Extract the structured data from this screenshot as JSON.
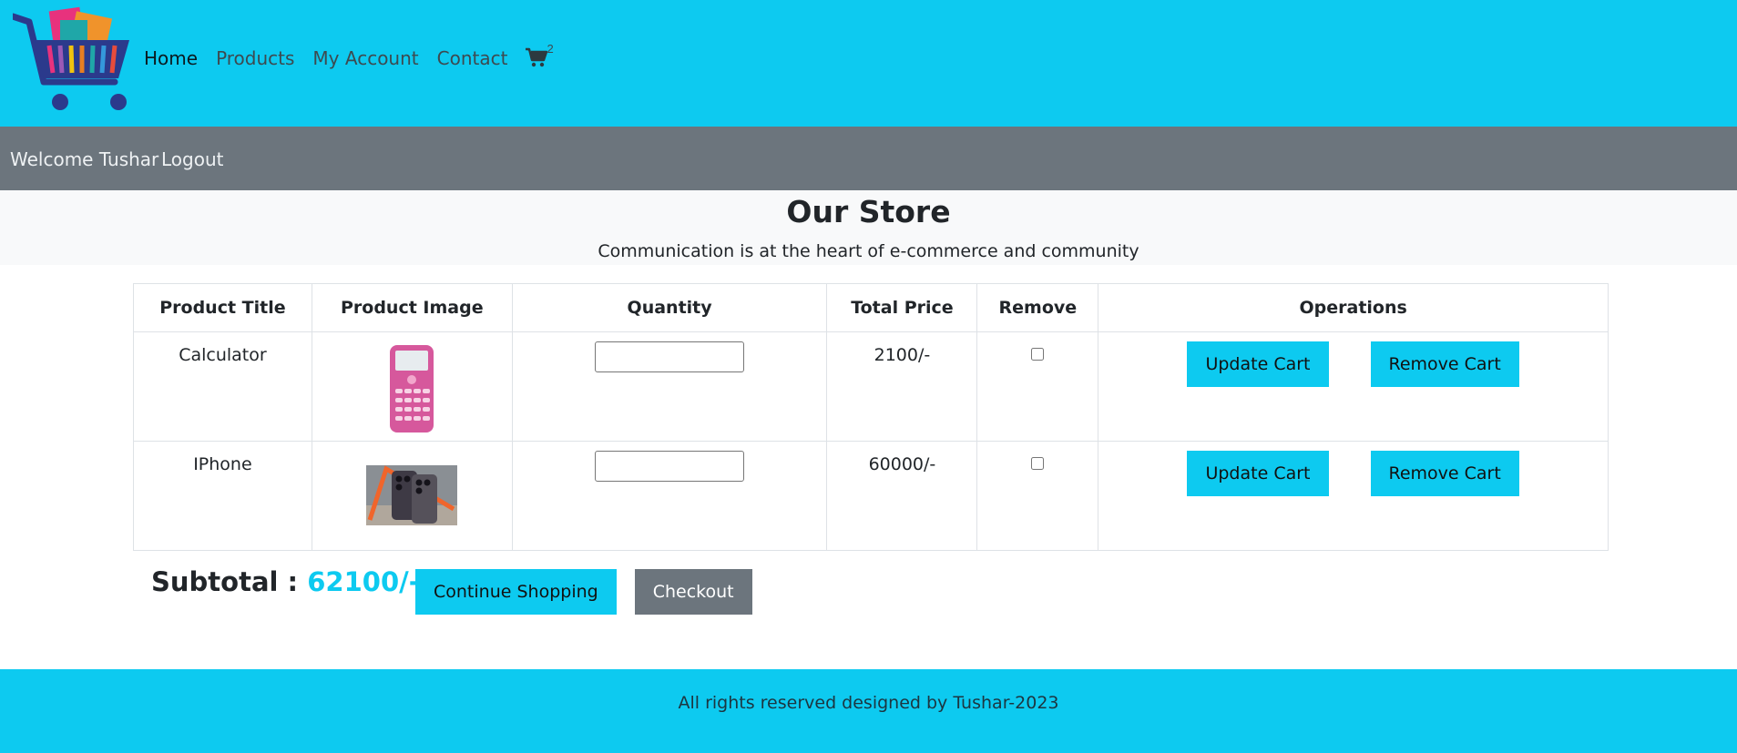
{
  "nav": {
    "home": "Home",
    "products": "Products",
    "account": "My Account",
    "contact": "Contact",
    "cart_count": "2"
  },
  "user": {
    "welcome": "Welcome Tushar",
    "logout": "Logout"
  },
  "hero": {
    "title": "Our Store",
    "subtitle": "Communication is at the heart of e-commerce and community"
  },
  "table": {
    "headers": [
      "Product Title",
      "Product Image",
      "Quantity",
      "Total Price",
      "Remove",
      "Operations"
    ],
    "rows": [
      {
        "title": "Calculator",
        "quantity": "",
        "price": "2100/-",
        "update_label": "Update Cart",
        "remove_label": "Remove Cart"
      },
      {
        "title": "IPhone",
        "quantity": "",
        "price": "60000/-",
        "update_label": "Update Cart",
        "remove_label": "Remove Cart"
      }
    ]
  },
  "summary": {
    "label": "Subtotal : ",
    "amount": "62100/-",
    "continue_label": "Continue Shopping",
    "checkout_label": "Checkout"
  },
  "footer": {
    "text": "All rights reserved designed by Tushar-2023"
  },
  "colors": {
    "accent": "#0dcaf0",
    "secondary": "#6c757d",
    "light": "#f8f9fa"
  }
}
